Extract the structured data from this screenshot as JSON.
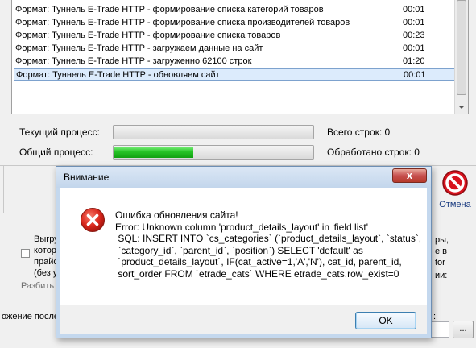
{
  "log": {
    "rows": [
      {
        "message": "Формат: Туннель E-Trade HTTP - формирование списка категорий товаров",
        "time": "00:01"
      },
      {
        "message": "Формат: Туннель E-Trade HTTP - формирование списка производителей товаров",
        "time": "00:01"
      },
      {
        "message": "Формат: Туннель E-Trade HTTP - формирование списка товаров",
        "time": "00:23"
      },
      {
        "message": "Формат: Туннель E-Trade HTTP - загружаем данные на сайт",
        "time": "00:01"
      },
      {
        "message": "Формат: Туннель E-Trade HTTP - загруженно 62100 строк",
        "time": "01:20"
      },
      {
        "message": "Формат: Туннель E-Trade HTTP - обновляем сайт",
        "time": "00:01"
      }
    ]
  },
  "progress": {
    "current_label": "Текущий процесс:",
    "current_fraction": 0,
    "total_label": "Общий процесс:",
    "total_fraction": 0.395,
    "total_rows": "Всего строк: 0",
    "processed_rows": "Обработано строк: 0"
  },
  "toolbar": {
    "cancel_label": "Отмена"
  },
  "background": {
    "opt_line1": "Выгру",
    "opt_line2": "котор",
    "opt_line3": "прайс",
    "opt_line4": "(без у",
    "split_label": "Разбить",
    "right_line1": "ры,",
    "right_line2": "е в",
    "right_line3": "tor",
    "right_line4": "ии:",
    "bottom_label": "ожение после",
    "bottom_colon": ":",
    "browse_label": "..."
  },
  "dialog": {
    "title": "Внимание",
    "close_glyph": "x",
    "message": "Ошибка обновления сайта!\nError: Unknown column 'product_details_layout' in 'field list'\n SQL: INSERT INTO `cs_categories` (`product_details_layout`, `status`,\n `category_id`, `parent_id`, `position`) SELECT 'default' as\n `product_details_layout`, IF(cat_active=1,'A','N'), cat_id, parent_id,\n sort_order FROM `etrade_cats` WHERE etrade_cats.row_exist=0",
    "ok_label": "OK"
  }
}
